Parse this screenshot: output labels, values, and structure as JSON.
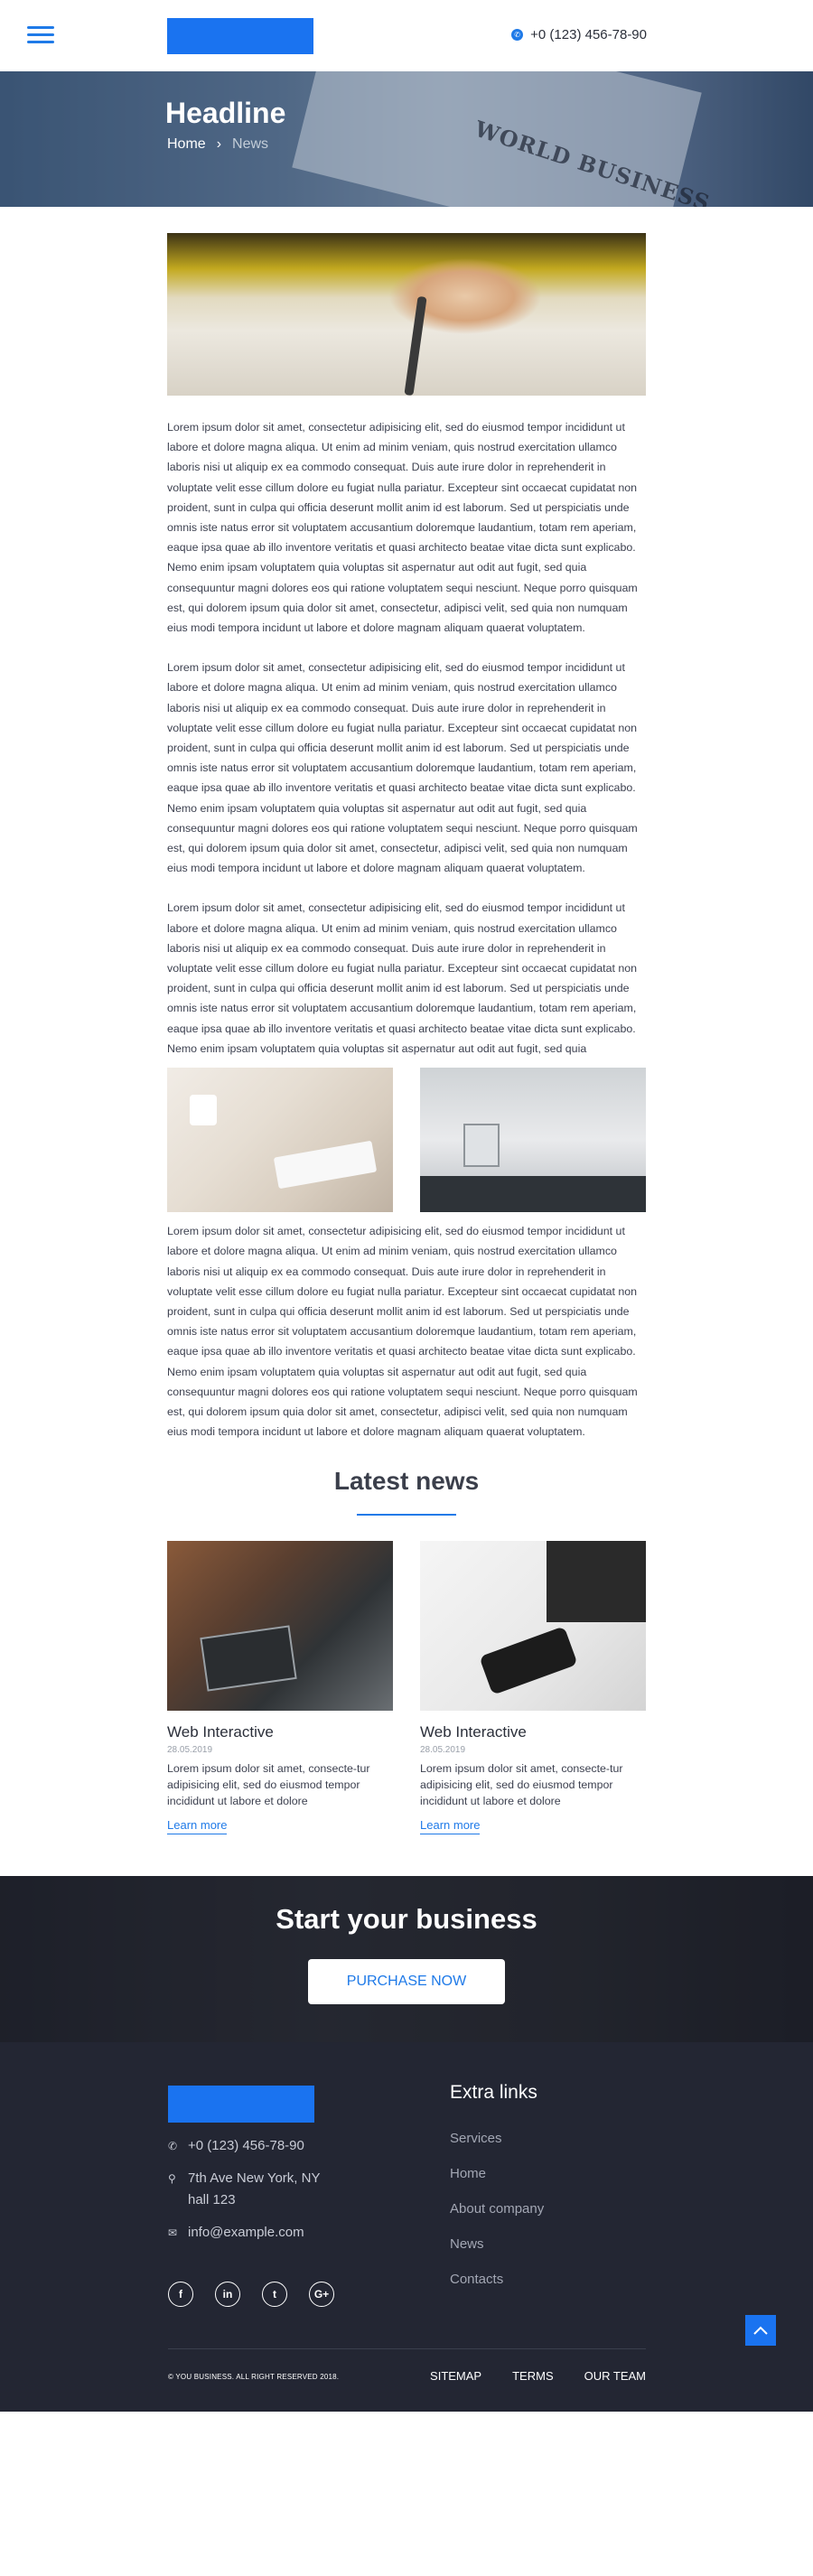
{
  "header": {
    "phone": "+0 (123) 456-78-90"
  },
  "hero": {
    "title": "Headline",
    "breadcrumb_home": "Home",
    "breadcrumb_separator": "›",
    "breadcrumb_current": "News"
  },
  "hero_background_text": "WORLD BUSINESS",
  "article": {
    "paragraphs": [
      "Lorem ipsum dolor sit amet, consectetur adipisicing elit, sed do eiusmod tempor incididunt ut labore et dolore magna aliqua. Ut enim ad minim veniam, quis nostrud exercitation ullamco laboris nisi ut aliquip ex ea commodo consequat. Duis aute irure dolor in reprehenderit in voluptate velit esse cillum dolore eu fugiat nulla pariatur. Excepteur sint occaecat cupidatat non proident, sunt in culpa qui officia deserunt mollit anim id est laborum. Sed ut perspiciatis unde omnis iste natus error sit voluptatem accusantium doloremque laudantium, totam rem aperiam, eaque ipsa quae ab illo inventore veritatis et quasi architecto beatae vitae dicta sunt explicabo. Nemo enim ipsam voluptatem quia voluptas sit aspernatur aut odit aut fugit, sed quia consequuntur magni dolores eos qui ratione voluptatem sequi nesciunt. Neque porro quisquam est, qui dolorem ipsum quia dolor sit amet, consectetur, adipisci velit, sed quia non numquam eius modi tempora incidunt ut labore et dolore magnam aliquam quaerat voluptatem.",
      "Lorem ipsum dolor sit amet, consectetur adipisicing elit, sed do eiusmod tempor incididunt ut labore et dolore magna aliqua. Ut enim ad minim veniam, quis nostrud exercitation ullamco laboris nisi ut aliquip ex ea commodo consequat. Duis aute irure dolor in reprehenderit in voluptate velit esse cillum dolore eu fugiat nulla pariatur. Excepteur sint occaecat cupidatat non proident, sunt in culpa qui officia deserunt mollit anim id est laborum. Sed ut perspiciatis unde omnis iste natus error sit voluptatem accusantium doloremque laudantium, totam rem aperiam, eaque ipsa quae ab illo inventore veritatis et quasi architecto beatae vitae dicta sunt explicabo. Nemo enim ipsam voluptatem quia voluptas sit aspernatur aut odit aut fugit, sed quia consequuntur magni dolores eos qui ratione voluptatem sequi nesciunt. Neque porro quisquam est, qui dolorem ipsum quia dolor sit amet, consectetur, adipisci velit, sed quia non numquam eius modi tempora incidunt ut labore et dolore magnam aliquam quaerat voluptatem.",
      "Lorem ipsum dolor sit amet, consectetur adipisicing elit, sed do eiusmod tempor incididunt ut labore et dolore magna aliqua. Ut enim ad minim veniam, quis nostrud exercitation ullamco laboris nisi ut aliquip ex ea commodo consequat. Duis aute irure dolor in reprehenderit in voluptate velit esse cillum dolore eu fugiat nulla pariatur. Excepteur sint occaecat cupidatat non proident, sunt in culpa qui officia deserunt mollit anim id est laborum. Sed ut perspiciatis unde omnis iste natus error sit voluptatem accusantium doloremque laudantium, totam rem aperiam, eaque ipsa quae ab illo inventore veritatis et quasi architecto beatae vitae dicta sunt explicabo. Nemo enim ipsam voluptatem quia voluptas sit aspernatur aut odit aut fugit, sed quia",
      "Lorem ipsum dolor sit amet, consectetur adipisicing elit, sed do eiusmod tempor incididunt ut labore et dolore magna aliqua. Ut enim ad minim veniam, quis nostrud exercitation ullamco laboris nisi ut aliquip ex ea commodo consequat. Duis aute irure dolor in reprehenderit in voluptate velit esse cillum dolore eu fugiat nulla pariatur. Excepteur sint occaecat cupidatat non proident, sunt in culpa qui officia deserunt mollit anim id est laborum. Sed ut perspiciatis unde omnis iste natus error sit voluptatem accusantium doloremque laudantium, totam rem aperiam, eaque ipsa quae ab illo inventore veritatis et quasi architecto beatae vitae dicta sunt explicabo. Nemo enim ipsam voluptatem quia voluptas sit aspernatur aut odit aut fugit, sed quia consequuntur magni dolores eos qui ratione voluptatem sequi nesciunt. Neque porro quisquam est, qui dolorem ipsum quia dolor sit amet, consectetur, adipisci velit, sed quia non numquam eius modi tempora incidunt ut labore et dolore magnam aliquam quaerat voluptatem."
    ]
  },
  "latest_news": {
    "title": "Latest news",
    "cards": [
      {
        "title": "Web Interactive",
        "date": "28.05.2019",
        "text": "Lorem ipsum dolor sit amet, consecte-tur adipisicing elit, sed do eiusmod tempor incididunt ut labore et dolore",
        "link": "Learn more"
      },
      {
        "title": "Web Interactive",
        "date": "28.05.2019",
        "text": "Lorem ipsum dolor sit amet, consecte-tur adipisicing elit, sed do eiusmod tempor incididunt ut labore et dolore",
        "link": "Learn more"
      }
    ]
  },
  "cta": {
    "title": "Start your business",
    "button": "PURCHASE NOW"
  },
  "footer": {
    "phone": "+0 (123) 456-78-90",
    "address": "7th Ave New York, NY hall 123",
    "email": "info@example.com",
    "socials": [
      "f",
      "in",
      "t",
      "G+"
    ],
    "links_title": "Extra links",
    "links": [
      "Services",
      "Home",
      "About company",
      "News",
      "Contacts"
    ],
    "copyright": "© YOU BUSINESS. ALL RIGHT RESERVED 2018.",
    "bottom_links": [
      "SITEMAP",
      "TERMS",
      "OUR TEAM"
    ]
  },
  "colors": {
    "accent": "#1f7ae8",
    "logo": "#1a73f0",
    "footer_bg": "#232633"
  },
  "icons": [
    "menu-icon",
    "phone-icon",
    "chevron-right-icon",
    "location-icon",
    "mail-icon",
    "facebook-icon",
    "linkedin-icon",
    "twitter-icon",
    "google-plus-icon",
    "arrow-up-icon"
  ]
}
